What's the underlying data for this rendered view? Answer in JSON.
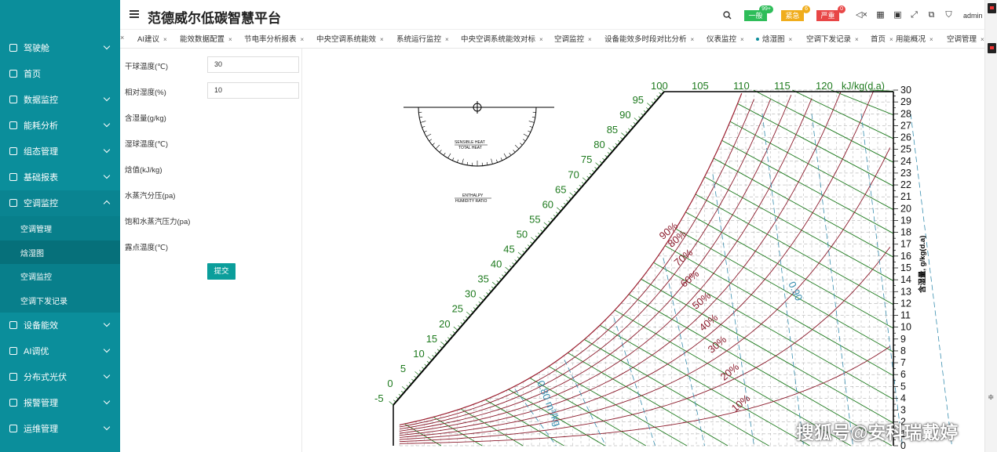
{
  "app": {
    "title": "范德威尔低碳智慧平台",
    "user": "admin"
  },
  "alerts": [
    {
      "label": "一般",
      "count": "99+",
      "bg": "#2ebd59",
      "count_bg": "#2ebd59"
    },
    {
      "label": "紧急",
      "count": "6",
      "bg": "#f0ad1c",
      "count_bg": "#f0ad1c"
    },
    {
      "label": "严重",
      "count": "0",
      "bg": "#e84646",
      "count_bg": "#e84646"
    }
  ],
  "sidebar": {
    "items": [
      {
        "label": "驾驶舱",
        "icon": "dashboard-icon",
        "has_chevron": true
      },
      {
        "label": "首页",
        "icon": "home-icon",
        "has_chevron": false
      },
      {
        "label": "数据监控",
        "icon": "monitor-icon",
        "has_chevron": true
      },
      {
        "label": "能耗分析",
        "icon": "bar-chart-icon",
        "has_chevron": true
      },
      {
        "label": "组态管理",
        "icon": "layout-icon",
        "has_chevron": true
      },
      {
        "label": "基础报表",
        "icon": "report-icon",
        "has_chevron": true
      },
      {
        "label": "空调监控",
        "icon": "snowflake-icon",
        "has_chevron": true,
        "expanded": true
      }
    ],
    "sub_items": [
      {
        "label": "空调管理",
        "active": false
      },
      {
        "label": "焓湿图",
        "active": true
      },
      {
        "label": "空调监控",
        "active": false
      },
      {
        "label": "空调下发记录",
        "active": false
      }
    ],
    "items_after": [
      {
        "label": "设备能效",
        "icon": "device-icon"
      },
      {
        "label": "AI调优",
        "icon": "ai-icon"
      },
      {
        "label": "分布式光伏",
        "icon": "solar-icon"
      },
      {
        "label": "报警管理",
        "icon": "alarm-icon"
      },
      {
        "label": "运维管理",
        "icon": "wrench-icon"
      }
    ]
  },
  "tabs": [
    {
      "label": "AI建议"
    },
    {
      "label": "能效数据配置"
    },
    {
      "label": "节电率分析报表"
    },
    {
      "label": "中央空调系统能效"
    },
    {
      "label": "系统运行监控"
    },
    {
      "label": "中央空调系统能效对标"
    },
    {
      "label": "空调监控"
    },
    {
      "label": "设备能效多时段对比分析"
    },
    {
      "label": "仪表监控"
    },
    {
      "label": "焓湿图",
      "active": true
    },
    {
      "label": "空调下发记录"
    },
    {
      "label": "首页"
    },
    {
      "label": "用能概况"
    },
    {
      "label": "空调管理"
    }
  ],
  "form": {
    "fields": [
      {
        "label": "干球温度(℃)",
        "value": "30"
      },
      {
        "label": "相对湿度(%)",
        "value": "10"
      },
      {
        "label": "含湿量(g/kg)",
        "value": ""
      },
      {
        "label": "湿球温度(℃)",
        "value": ""
      },
      {
        "label": "焓值(kJ/kg)",
        "value": ""
      },
      {
        "label": "水蒸汽分压(pa)",
        "value": ""
      },
      {
        "label": "饱和水蒸汽压力(pa)",
        "value": ""
      },
      {
        "label": "露点温度(℃)",
        "value": ""
      }
    ],
    "submit_label": "提交"
  },
  "chart": {
    "enthalpy_unit": "kJ/kg(d.a)",
    "moisture_axis_label": "含湿量, g/kg(d.a)",
    "enthalpy_top_labels": [
      "100",
      "105",
      "110",
      "115",
      "120"
    ],
    "enthalpy_diag_labels": [
      "95",
      "90",
      "85",
      "80",
      "75",
      "70",
      "65",
      "60",
      "55",
      "50",
      "45",
      "40",
      "35",
      "30",
      "25",
      "20",
      "15",
      "10",
      "5",
      "0",
      "-5"
    ],
    "moisture_ticks": [
      "30",
      "29",
      "28",
      "27",
      "26",
      "25",
      "24",
      "23",
      "22",
      "21",
      "20",
      "19",
      "18",
      "17",
      "16",
      "15",
      "14",
      "13",
      "12",
      "11",
      "10",
      "9",
      "8",
      "7",
      "6",
      "5",
      "4",
      "3",
      "2",
      "1",
      "0"
    ],
    "rh_labels": [
      "90%",
      "80%",
      "70%",
      "60%",
      "50%",
      "40%",
      "30%",
      "20%",
      "10%"
    ],
    "specific_volume_labels": [
      "0.90",
      "0.80 m³/kg"
    ],
    "protractor": {
      "sensible_heat": "SENSIBLE HEAT",
      "total_heat": "TOTAL HEAT",
      "enthalpy": "ENTHALPY",
      "humidity_ratio": "HUMIDITY RATIO"
    },
    "colors": {
      "enthalpy": "#1e7a1e",
      "rh": "#8b1a2b",
      "volume": "#3a8fb0",
      "grid": "#888888"
    }
  },
  "watermark": "搜狐号@安科瑞戴婷"
}
